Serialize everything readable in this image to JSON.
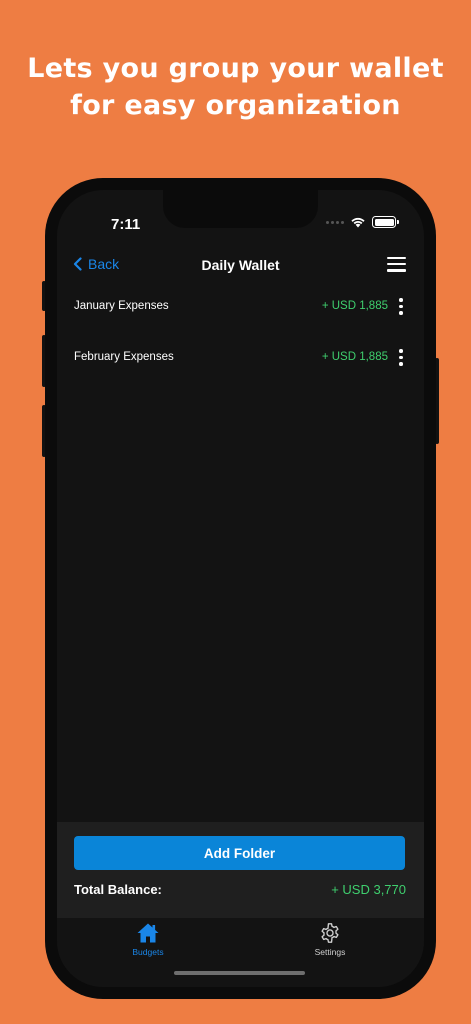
{
  "headline": {
    "line1": "Lets you group your wallet",
    "line2": "for easy organization"
  },
  "status_bar": {
    "time": "7:11"
  },
  "nav": {
    "back_label": "Back",
    "title": "Daily Wallet"
  },
  "folders": [
    {
      "name": "January Expenses",
      "amount": "+ USD 1,885"
    },
    {
      "name": "February Expenses",
      "amount": "+ USD 1,885"
    }
  ],
  "footer": {
    "add_folder_label": "Add Folder",
    "total_label": "Total Balance:",
    "total_amount": "+ USD 3,770"
  },
  "tabs": [
    {
      "label": "Budgets",
      "icon": "home-icon",
      "active": true
    },
    {
      "label": "Settings",
      "icon": "gear-icon",
      "active": false
    }
  ],
  "colors": {
    "background": "#EE7D43",
    "accent": "#0A85D8",
    "positive": "#3FCF6E",
    "screen": "#131313"
  }
}
